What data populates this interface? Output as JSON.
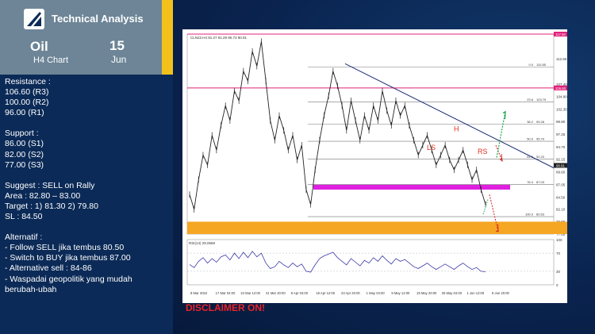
{
  "header": {
    "title": "Technical Analysis",
    "instrument": "Oil",
    "timeframe": "H4 Chart",
    "day": "15",
    "month": "Jun"
  },
  "levels_text": {
    "resistance_heading": "Resistance :",
    "resistance": [
      "106.60 (R3)",
      "100.00 (R2)",
      "96.00 (R1)"
    ],
    "support_heading": "Support :",
    "support": [
      "86.00 (S1)",
      "82.00 (S2)",
      "77.00 (S3)"
    ],
    "suggest": "Suggest : SELL on Rally",
    "area": "Area : 82.80 – 83.00",
    "target": "Target : 1) 81.30 2) 79.80",
    "sl": "SL : 84.50",
    "alternatif_heading": "Alternatif :",
    "alternatif": [
      "- Follow SELL jika tembus  80.50",
      "- Switch to BUY jika  tembus 87.00",
      "- Alternative sell : 84-86",
      "- Waspadai geopolitik yang mudah berubah-ubah"
    ]
  },
  "disclaimer": "DISCLAIMER ON!",
  "colors": {
    "accent_yellow": "#f2c21b",
    "resistance_line": "#e0207a",
    "support_zone": "#e020e0",
    "target_zone": "#f5a623",
    "candles": "#222222",
    "rsi_line": "#3a3aa8",
    "trendline": "#1c2a78",
    "annotation_red": "#e0321e",
    "arrow_green": "#18a34a",
    "arrow_red": "#d42020",
    "disclaimer_red": "#e8232a"
  },
  "chart_data": {
    "type": "line",
    "symbol_header": "CLN22.H4 91.27 91.29 90.73 90.91",
    "y_ticks": [
      "117.50",
      "112.50",
      "107.40",
      "104.90",
      "102.35",
      "99.80",
      "97.25",
      "94.70",
      "92.15",
      "89.60",
      "87.05",
      "84.50",
      "82.10",
      "79.55",
      "77.00"
    ],
    "ylim": [
      77.0,
      117.5
    ],
    "x_labels": [
      "8 Mar 2022",
      "17 Mar 04:00",
      "24 Mar 12:00",
      "31 Mar 20:00",
      "9 Apr 04:00",
      "18 Apr 12:00",
      "23 Apr 20:00",
      "1 May 04:00",
      "9 May 12:00",
      "19 May 20:00",
      "25 May 04:00",
      "1 Jun 12:00",
      "8 Jun 20:00"
    ],
    "price_label_right": "90.91",
    "horizontal_levels": [
      {
        "label": "106.60",
        "value": 106.6,
        "kind": "resistance"
      },
      {
        "label": "117.50",
        "value": 117.5,
        "kind": "resistance"
      }
    ],
    "fibonacci": [
      {
        "label": "0.0",
        "value": 110.85
      },
      {
        "label": "23.6",
        "value": 103.79
      },
      {
        "label": "38.2",
        "value": 99.28
      },
      {
        "label": "50.0",
        "value": 95.79
      },
      {
        "label": "61.8",
        "value": 92.2
      },
      {
        "label": "76.4",
        "value": 87.03
      },
      {
        "label": "100.0",
        "value": 80.53
      }
    ],
    "zones": [
      {
        "name": "support",
        "from": 86.0,
        "to": 87.0
      },
      {
        "name": "target",
        "from": 77.0,
        "to": 79.5
      }
    ],
    "pattern_labels": [
      "LS",
      "H",
      "RS"
    ],
    "price_series": [
      85,
      82,
      88,
      93,
      91,
      97,
      94,
      99,
      103,
      100,
      106,
      104,
      110,
      108,
      114,
      111,
      116,
      108,
      100,
      96,
      101,
      98,
      94,
      97,
      92,
      95,
      86,
      83,
      90,
      96,
      101,
      105,
      110,
      107,
      103,
      98,
      104,
      100,
      96,
      101,
      98,
      103,
      100,
      106,
      102,
      99,
      104,
      101,
      103,
      99,
      96,
      93,
      95,
      97,
      94,
      91,
      93,
      95,
      92,
      90,
      92,
      94,
      91,
      88,
      90,
      86,
      83
    ],
    "rsi": {
      "label": "RSI(14) 29.0569",
      "ylim": [
        0,
        100
      ],
      "ticks": [
        "100",
        "70",
        "30",
        "0"
      ],
      "values": [
        45,
        38,
        52,
        60,
        48,
        58,
        50,
        62,
        66,
        55,
        70,
        58,
        72,
        60,
        74,
        62,
        70,
        48,
        36,
        40,
        52,
        44,
        38,
        48,
        40,
        46,
        30,
        28,
        44,
        58,
        64,
        68,
        72,
        60,
        52,
        44,
        58,
        50,
        42,
        54,
        48,
        60,
        52,
        64,
        54,
        46,
        58,
        52,
        56,
        48,
        40,
        36,
        42,
        48,
        40,
        34,
        40,
        46,
        40,
        34,
        42,
        48,
        40,
        34,
        38,
        30,
        29
      ]
    }
  }
}
